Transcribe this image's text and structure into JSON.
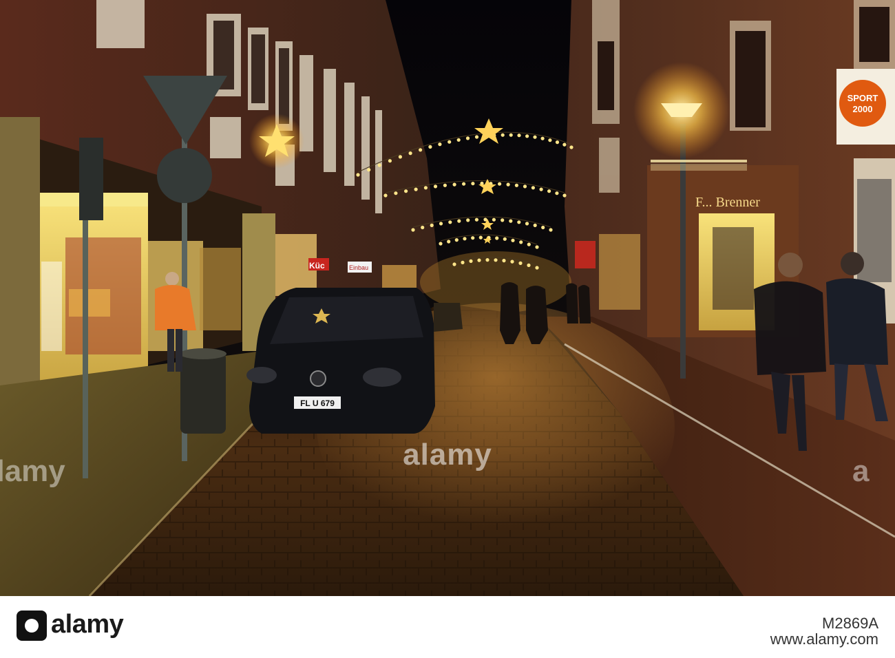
{
  "photo": {
    "signs": {
      "sport_line1": "SPORT",
      "sport_line2": "2000",
      "shop_left": "Küc",
      "shop_mid": "Einbau",
      "shop_right": "F... Brenner",
      "plate": "FL U 679"
    }
  },
  "watermark": {
    "center": "alamy",
    "left": "alamy",
    "right": "a"
  },
  "footer": {
    "logo": "alamy",
    "image_id": "M2869A",
    "id_prefix": "www.alamy.com"
  },
  "colors": {
    "sky": "#07060a",
    "shop_glow": "#f5d46a",
    "lamp": "#ffcf55",
    "cobble": "#3a2410"
  }
}
